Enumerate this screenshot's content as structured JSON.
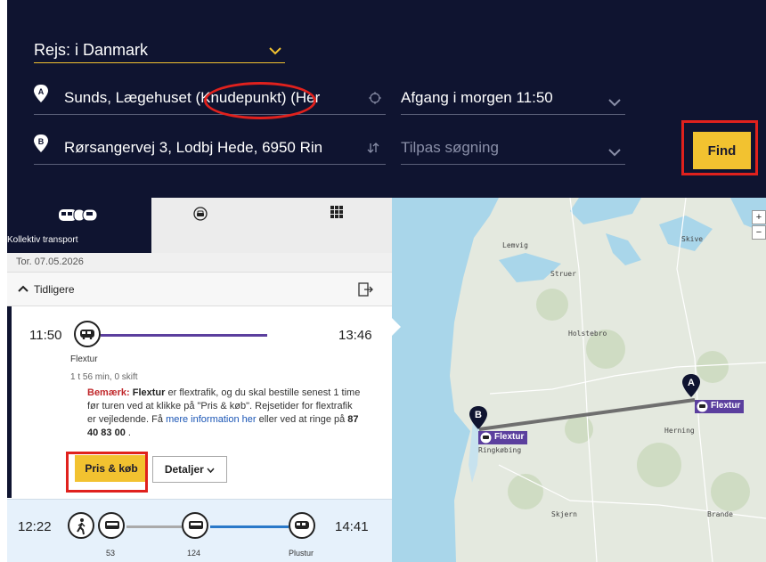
{
  "search": {
    "scope_label": "Rejs: i Danmark",
    "from_value": "Sunds, Lægehuset (Knudepunkt) (Her",
    "to_value": "Rørsangervej 3, Lodbj Hede, 6950 Rin",
    "departure_label": "Afgang  i morgen  11:50",
    "options_placeholder": "Tilpas søgning",
    "find_label": "Find",
    "from_marker": "A",
    "to_marker": "B"
  },
  "tabs": {
    "transit_label": "Kollektiv transport",
    "icons": [
      "bus-train-icon",
      "car-icon",
      "grid-icon"
    ]
  },
  "results": {
    "date": "Tor. 07.05.2026",
    "earlier_label": "Tidligere",
    "trip1": {
      "depart": "11:50",
      "arrive": "13:46",
      "mode": "Flextur",
      "duration": "1 t 56 min, 0 skift",
      "note_warn": "Bemærk:",
      "note_bold": "Flextur",
      "note_text1": " er flextrafik, og du skal bestille senest 1 time før turen ved at klikke på \"Pris & køb\". Rejsetider for flextrafik er vejledende. Få ",
      "note_link": "mere information her",
      "note_text2": " eller ved at ringe på ",
      "note_phone": "87 40 83 00",
      "note_end": " .",
      "buy_label": "Pris & køb",
      "details_label": "Detaljer"
    },
    "trip2": {
      "depart": "12:22",
      "arrive": "14:41",
      "legs": [
        "53",
        "124",
        "Plustur"
      ]
    }
  },
  "map": {
    "cities": [
      "Lemvig",
      "Struer",
      "Skive",
      "Holstebro",
      "Herning",
      "Ringkøbing",
      "Skjern",
      "Brande"
    ],
    "marker_a": "A",
    "marker_b": "B",
    "tag_a": "Flextur",
    "tag_b": "Flextur",
    "zoom_in": "+",
    "zoom_out": "−"
  },
  "colors": {
    "navy": "#0f1430",
    "accent_yellow": "#f2c230",
    "highlight_red": "#e0211d",
    "flextur_purple": "#5b3f9e",
    "bus_blue": "#2a79c9"
  }
}
